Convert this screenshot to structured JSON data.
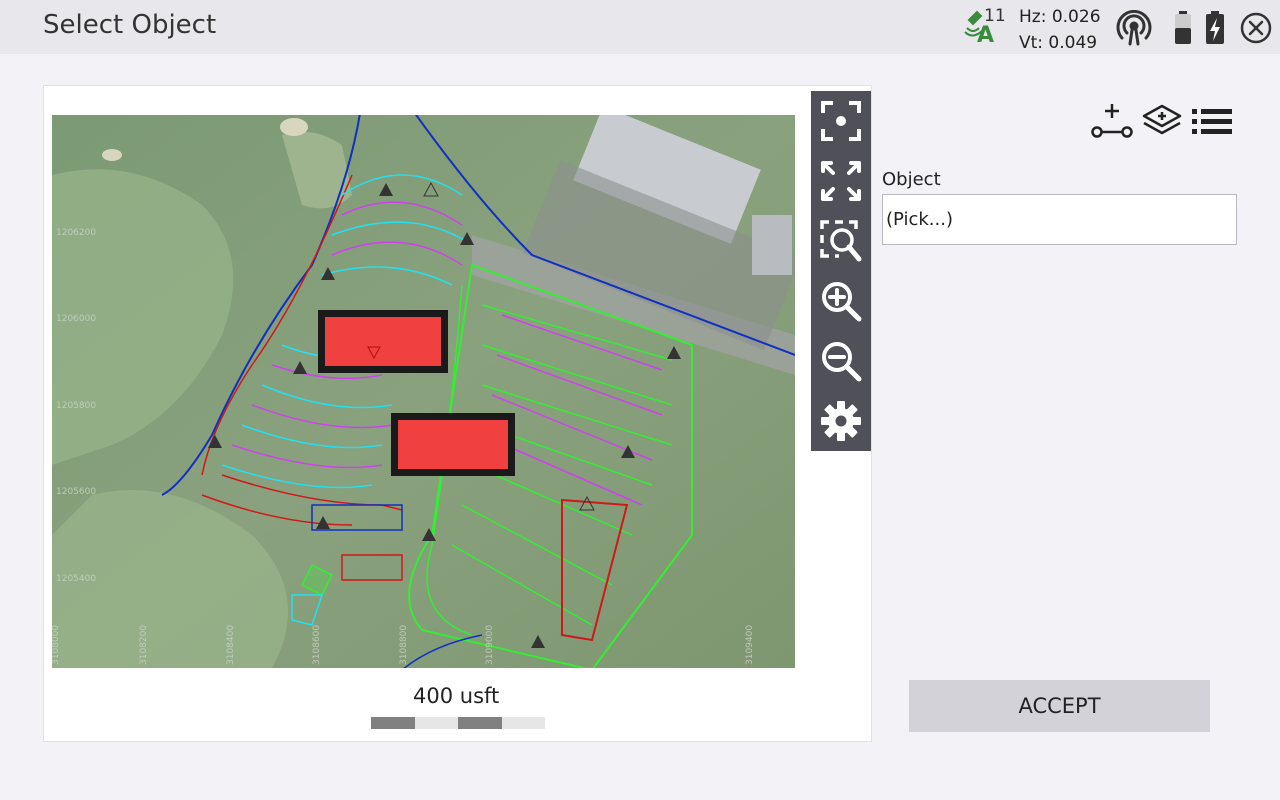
{
  "header": {
    "title": "Select Object",
    "satellites": "11",
    "gnss_mode": "A",
    "hz": "Hz: 0.026",
    "vt": "Vt: 0.049",
    "icons": [
      "gnss-satellite-icon",
      "radio-signal-icon",
      "battery-icon",
      "battery-charging-icon",
      "close-icon"
    ]
  },
  "map": {
    "scale_label": "400 usft",
    "toolbar": [
      "zoom-to-selection-icon",
      "zoom-extents-icon",
      "zoom-window-icon",
      "zoom-in-icon",
      "zoom-out-icon",
      "settings-gear-icon"
    ],
    "grid_labels": {
      "northing": [
        "1206200",
        "1206000",
        "1205800",
        "1205600",
        "1205400"
      ],
      "easting": [
        "3108000",
        "3108200",
        "3108400",
        "3108600",
        "3108800",
        "3109000",
        "3109400"
      ]
    }
  },
  "panel": {
    "tools": [
      "add-point-icon",
      "layers-icon",
      "list-icon"
    ],
    "object_label": "Object",
    "object_value": "(Pick...)",
    "accept_label": "ACCEPT"
  },
  "colors": {
    "accent": "#505058",
    "building": "#f04040",
    "linework_green": "#33ee33",
    "linework_cyan": "#22e0f0",
    "linework_magenta": "#d040f0",
    "linework_red": "#d01818",
    "linework_blue": "#1030c0"
  }
}
